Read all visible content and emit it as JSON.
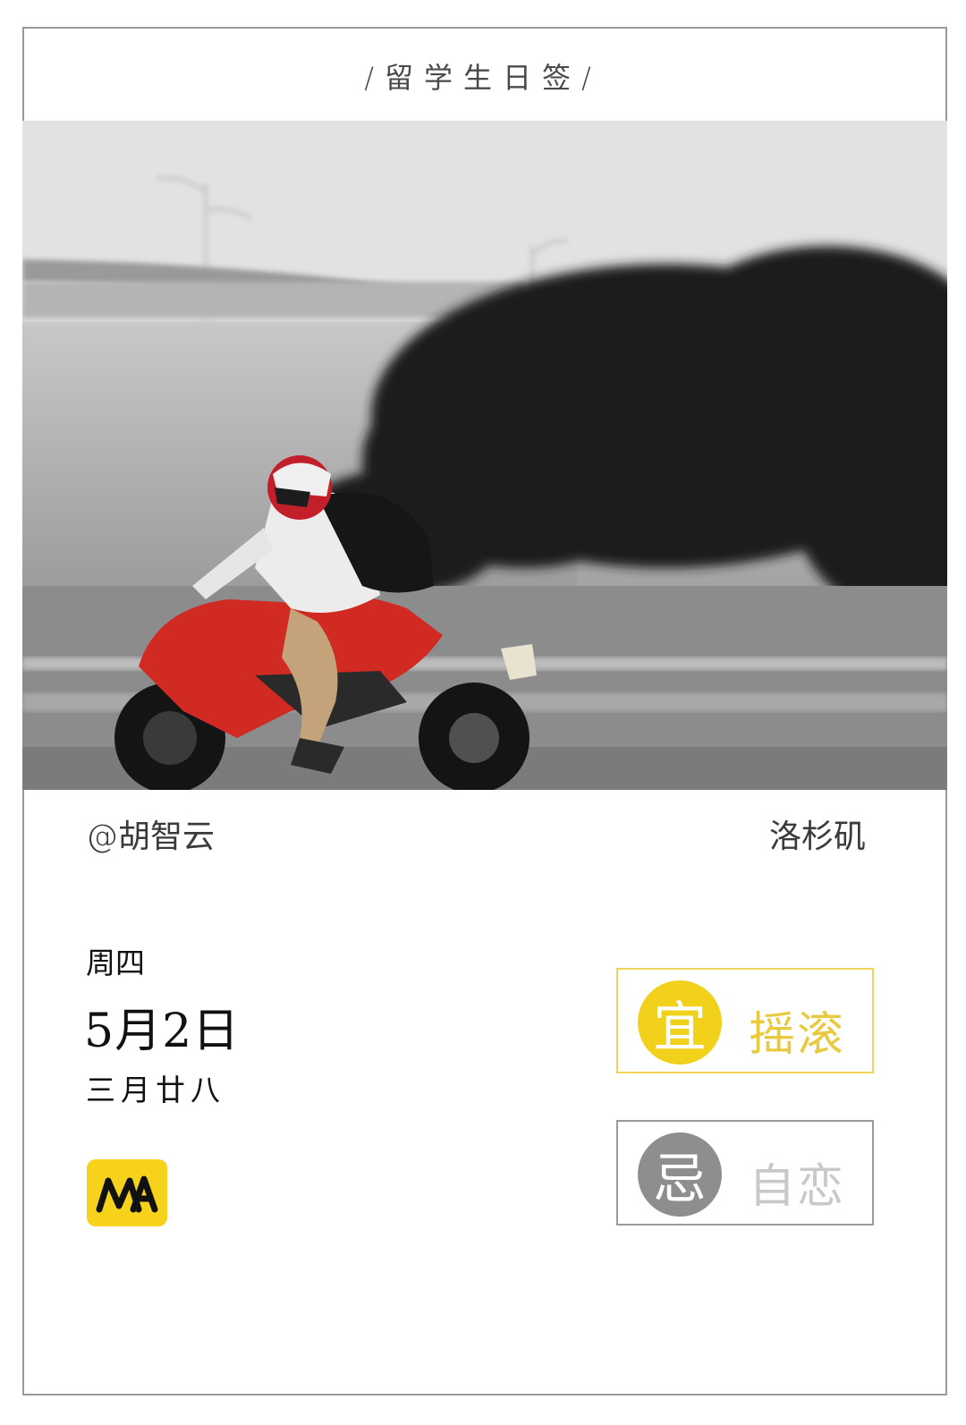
{
  "header": {
    "title": "/留学生日签/"
  },
  "photo": {
    "alt": "Motorcyclist with red sport bike on a highway, monochrome background"
  },
  "credits": {
    "author": "@胡智云",
    "location": "洛杉矶"
  },
  "calendar": {
    "weekday": "周四",
    "date": "5月2日",
    "lunar": "三月廿八"
  },
  "fortune": {
    "yi": {
      "label": "宜",
      "text": "摇滚"
    },
    "ji": {
      "label": "忌",
      "text": "自恋"
    }
  },
  "colors": {
    "accent_yellow": "#f2d11d",
    "grey": "#8e8e8e"
  }
}
